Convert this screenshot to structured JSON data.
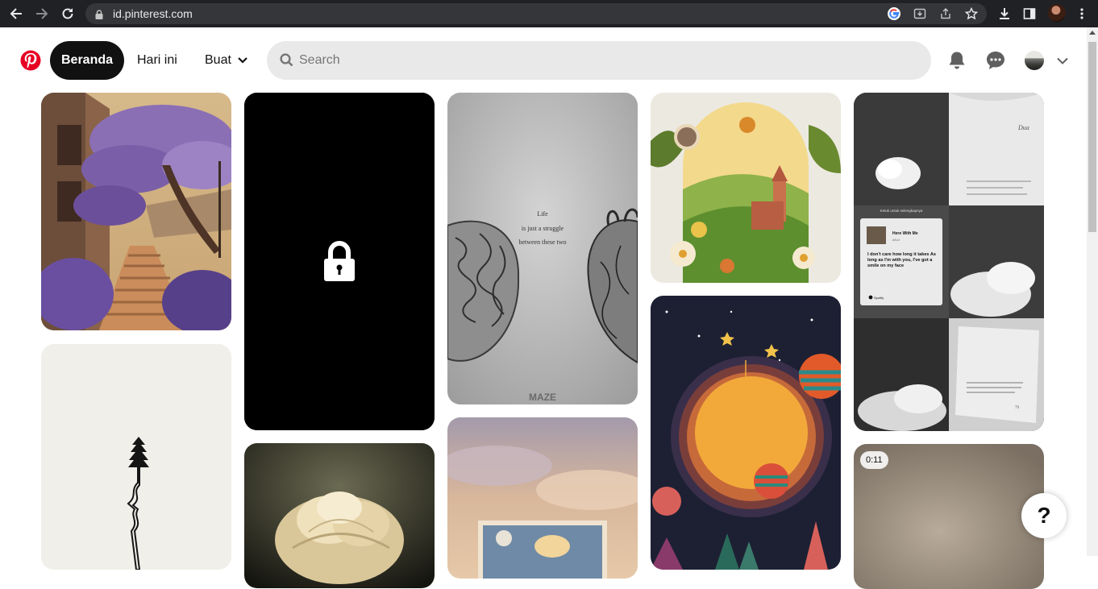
{
  "browser": {
    "url": "id.pinterest.com",
    "icons": [
      "back-arrow-icon",
      "forward-arrow-icon",
      "reload-icon",
      "lock-icon",
      "google-icon",
      "install-app-icon",
      "share-icon",
      "star-icon",
      "download-icon",
      "side-panel-icon",
      "profile-avatar",
      "menu-dots-icon"
    ]
  },
  "header": {
    "home_label": "Beranda",
    "today_label": "Hari ini",
    "create_label": "Buat",
    "search_placeholder": "Search",
    "brand_color": "#e60023"
  },
  "pins": [
    {
      "id": "pin-stairs-garden"
    },
    {
      "id": "pin-lock-black"
    },
    {
      "id": "pin-brain-heart",
      "text": [
        "Life",
        "is just a struggle",
        "between these two"
      ],
      "watermark": "MAZE"
    },
    {
      "id": "pin-quilled-landscape"
    },
    {
      "id": "pin-bw-collage",
      "top_caption": "Ketuk untuk selengkapnya",
      "song": {
        "title": "Here With Me",
        "artist": "d4vd",
        "lyrics": "I don't care how long it takes As long as I'm with you, I've got a smile on my face",
        "source": "Spotify"
      },
      "book_word": "Dua",
      "page_number": "79"
    },
    {
      "id": "pin-tree-line"
    },
    {
      "id": "pin-peony"
    },
    {
      "id": "pin-sky-window"
    },
    {
      "id": "pin-space-paper"
    },
    {
      "id": "pin-video",
      "duration": "0:11"
    }
  ],
  "help_label": "?"
}
